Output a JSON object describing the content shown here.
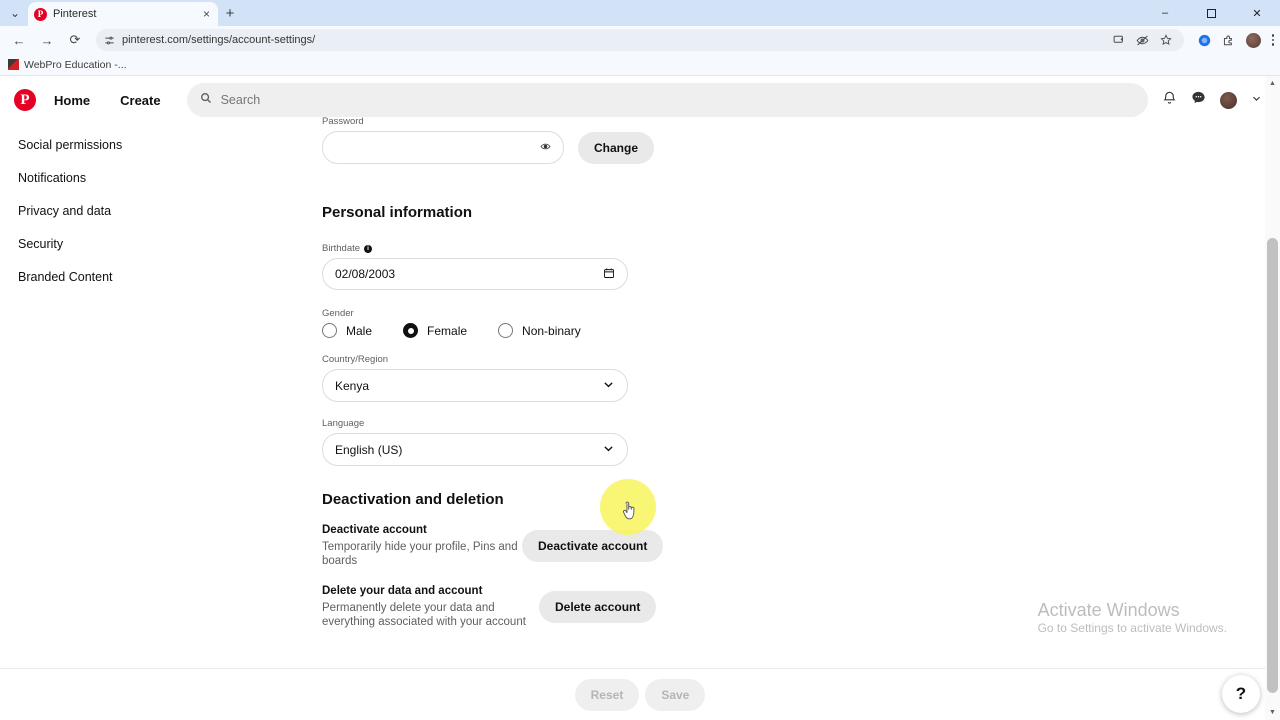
{
  "browser": {
    "tab": {
      "title": "Pinterest",
      "favicon": "pinterest-icon",
      "close": "×"
    },
    "new_tab": "+",
    "tab_list_chevron": "⌄",
    "window_controls": {
      "minimize": "–",
      "maximize": "❐",
      "close": "✕"
    },
    "nav": {
      "back": "←",
      "forward": "→",
      "reload": "⟳"
    },
    "omnibox": {
      "url": "pinterest.com/settings/account-settings/",
      "site_settings_icon": "tune-icon"
    },
    "omni_actions": [
      "cast-icon",
      "eye-slash-icon",
      "star-icon"
    ],
    "toolbar_right": [
      "sync-circle-icon",
      "extensions-icon",
      "profile-avatar",
      "kebab-menu-icon"
    ],
    "bookmarks": [
      {
        "label": "WebPro Education -..."
      }
    ]
  },
  "pinterest_header": {
    "logo": "P",
    "home_label": "Home",
    "create_label": "Create",
    "search_placeholder": "Search",
    "search_value": "",
    "icons": [
      "bell-icon",
      "messages-icon",
      "avatar",
      "chevron-down-icon"
    ]
  },
  "sidebar": {
    "items": [
      {
        "label": "Social permissions"
      },
      {
        "label": "Notifications"
      },
      {
        "label": "Privacy and data"
      },
      {
        "label": "Security"
      },
      {
        "label": "Branded Content"
      }
    ]
  },
  "main": {
    "password": {
      "label": "Password",
      "value": "",
      "reveal_icon": "eye-icon",
      "change_button": "Change"
    },
    "personal_information": {
      "title": "Personal information",
      "birthdate": {
        "label": "Birthdate",
        "info_icon": "info-icon",
        "value": "02/08/2003",
        "calendar_icon": "calendar-icon"
      },
      "gender": {
        "label": "Gender",
        "options": [
          {
            "label": "Male",
            "selected": false
          },
          {
            "label": "Female",
            "selected": true
          },
          {
            "label": "Non-binary",
            "selected": false
          }
        ]
      },
      "country": {
        "label": "Country/Region",
        "value": "Kenya",
        "chevron": "chevron-down-icon"
      },
      "language": {
        "label": "Language",
        "value": "English (US)",
        "chevron": "chevron-down-icon"
      }
    },
    "deactivation": {
      "title": "Deactivation and deletion",
      "deactivate": {
        "title": "Deactivate account",
        "description": "Temporarily hide your profile, Pins and boards",
        "button": "Deactivate account"
      },
      "delete": {
        "title": "Delete your data and account",
        "description": "Permanently delete your data and everything associated with your account",
        "button": "Delete account"
      }
    }
  },
  "footer": {
    "reset_label": "Reset",
    "save_label": "Save",
    "help_label": "?"
  },
  "watermark": {
    "line1": "Activate Windows",
    "line2": "Go to Settings to activate Windows."
  },
  "colors": {
    "brand_red": "#e60023",
    "highlight_yellow": "#f7f55c",
    "tabstrip_blue": "#d2e3f7"
  }
}
